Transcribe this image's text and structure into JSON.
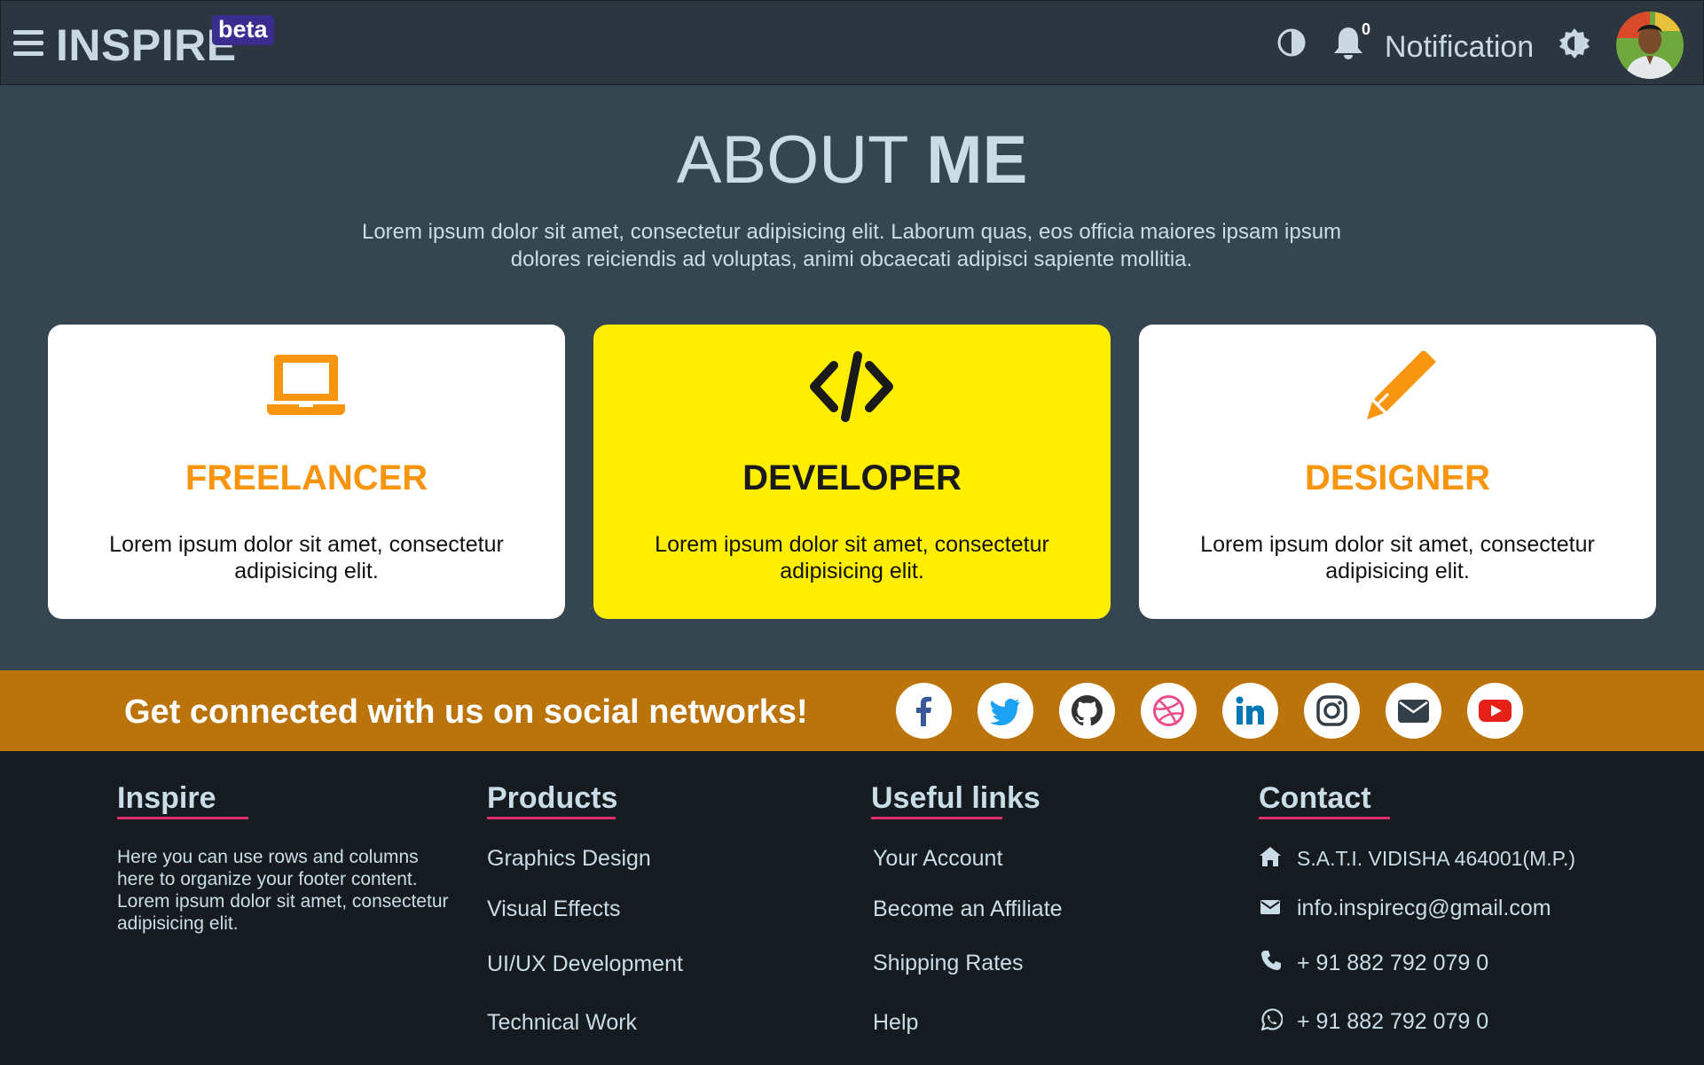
{
  "navbar": {
    "brand": "INSPIRE",
    "badge": "beta",
    "notification_count": "0",
    "notification_label": "Notification"
  },
  "about": {
    "title_light": "ABOUT",
    "title_bold": "ME",
    "text": "Lorem ipsum dolor sit amet, consectetur adipisicing elit. Laborum quas, eos officia maiores ipsam ipsum dolores reiciendis ad voluptas, animi obcaecati adipisci sapiente mollitia.",
    "cards": [
      {
        "icon": "laptop-icon",
        "title": "FREELANCER",
        "text": "Lorem ipsum dolor sit amet, consectetur adipisicing elit."
      },
      {
        "icon": "code-icon",
        "title": "DEVELOPER",
        "text": "Lorem ipsum dolor sit amet, consectetur adipisicing elit."
      },
      {
        "icon": "pencil-icon",
        "title": "DESIGNER",
        "text": "Lorem ipsum dolor sit amet, consectetur adipisicing elit."
      }
    ]
  },
  "social": {
    "text": "Get connected with us on social networks!",
    "icons": [
      "facebook-icon",
      "twitter-icon",
      "github-icon",
      "dribbble-icon",
      "linkedin-icon",
      "instagram-icon",
      "email-icon",
      "youtube-icon"
    ]
  },
  "footer": {
    "inspire": {
      "heading": "Inspire",
      "text": "Here you can use rows and columns here to organize your footer content. Lorem ipsum dolor sit amet, consectetur adipisicing elit."
    },
    "products": {
      "heading": "Products",
      "links": [
        "Graphics Design",
        "Visual Effects",
        "UI/UX Development",
        "Technical Work"
      ]
    },
    "useful": {
      "heading": "Useful links",
      "links": [
        "Your Account",
        "Become an Affiliate",
        "Shipping Rates",
        "Help"
      ]
    },
    "contact": {
      "heading": "Contact",
      "address": "S.A.T.I. VIDISHA 464001(M.P.)",
      "email": "info.inspirecg@gmail.com",
      "phone": "+ 91 882 792 079 0",
      "whatsapp": "+ 91 882 792 079 0"
    }
  },
  "colors": {
    "navbar": "#2b3640",
    "about_bg": "#364650",
    "accent_orange": "#f7960e",
    "developer_card": "#ffee00",
    "social_bar": "#bb730c",
    "footer_bg": "#151b1f",
    "underline": "#e0306b",
    "badge": "#3a2d8f"
  }
}
